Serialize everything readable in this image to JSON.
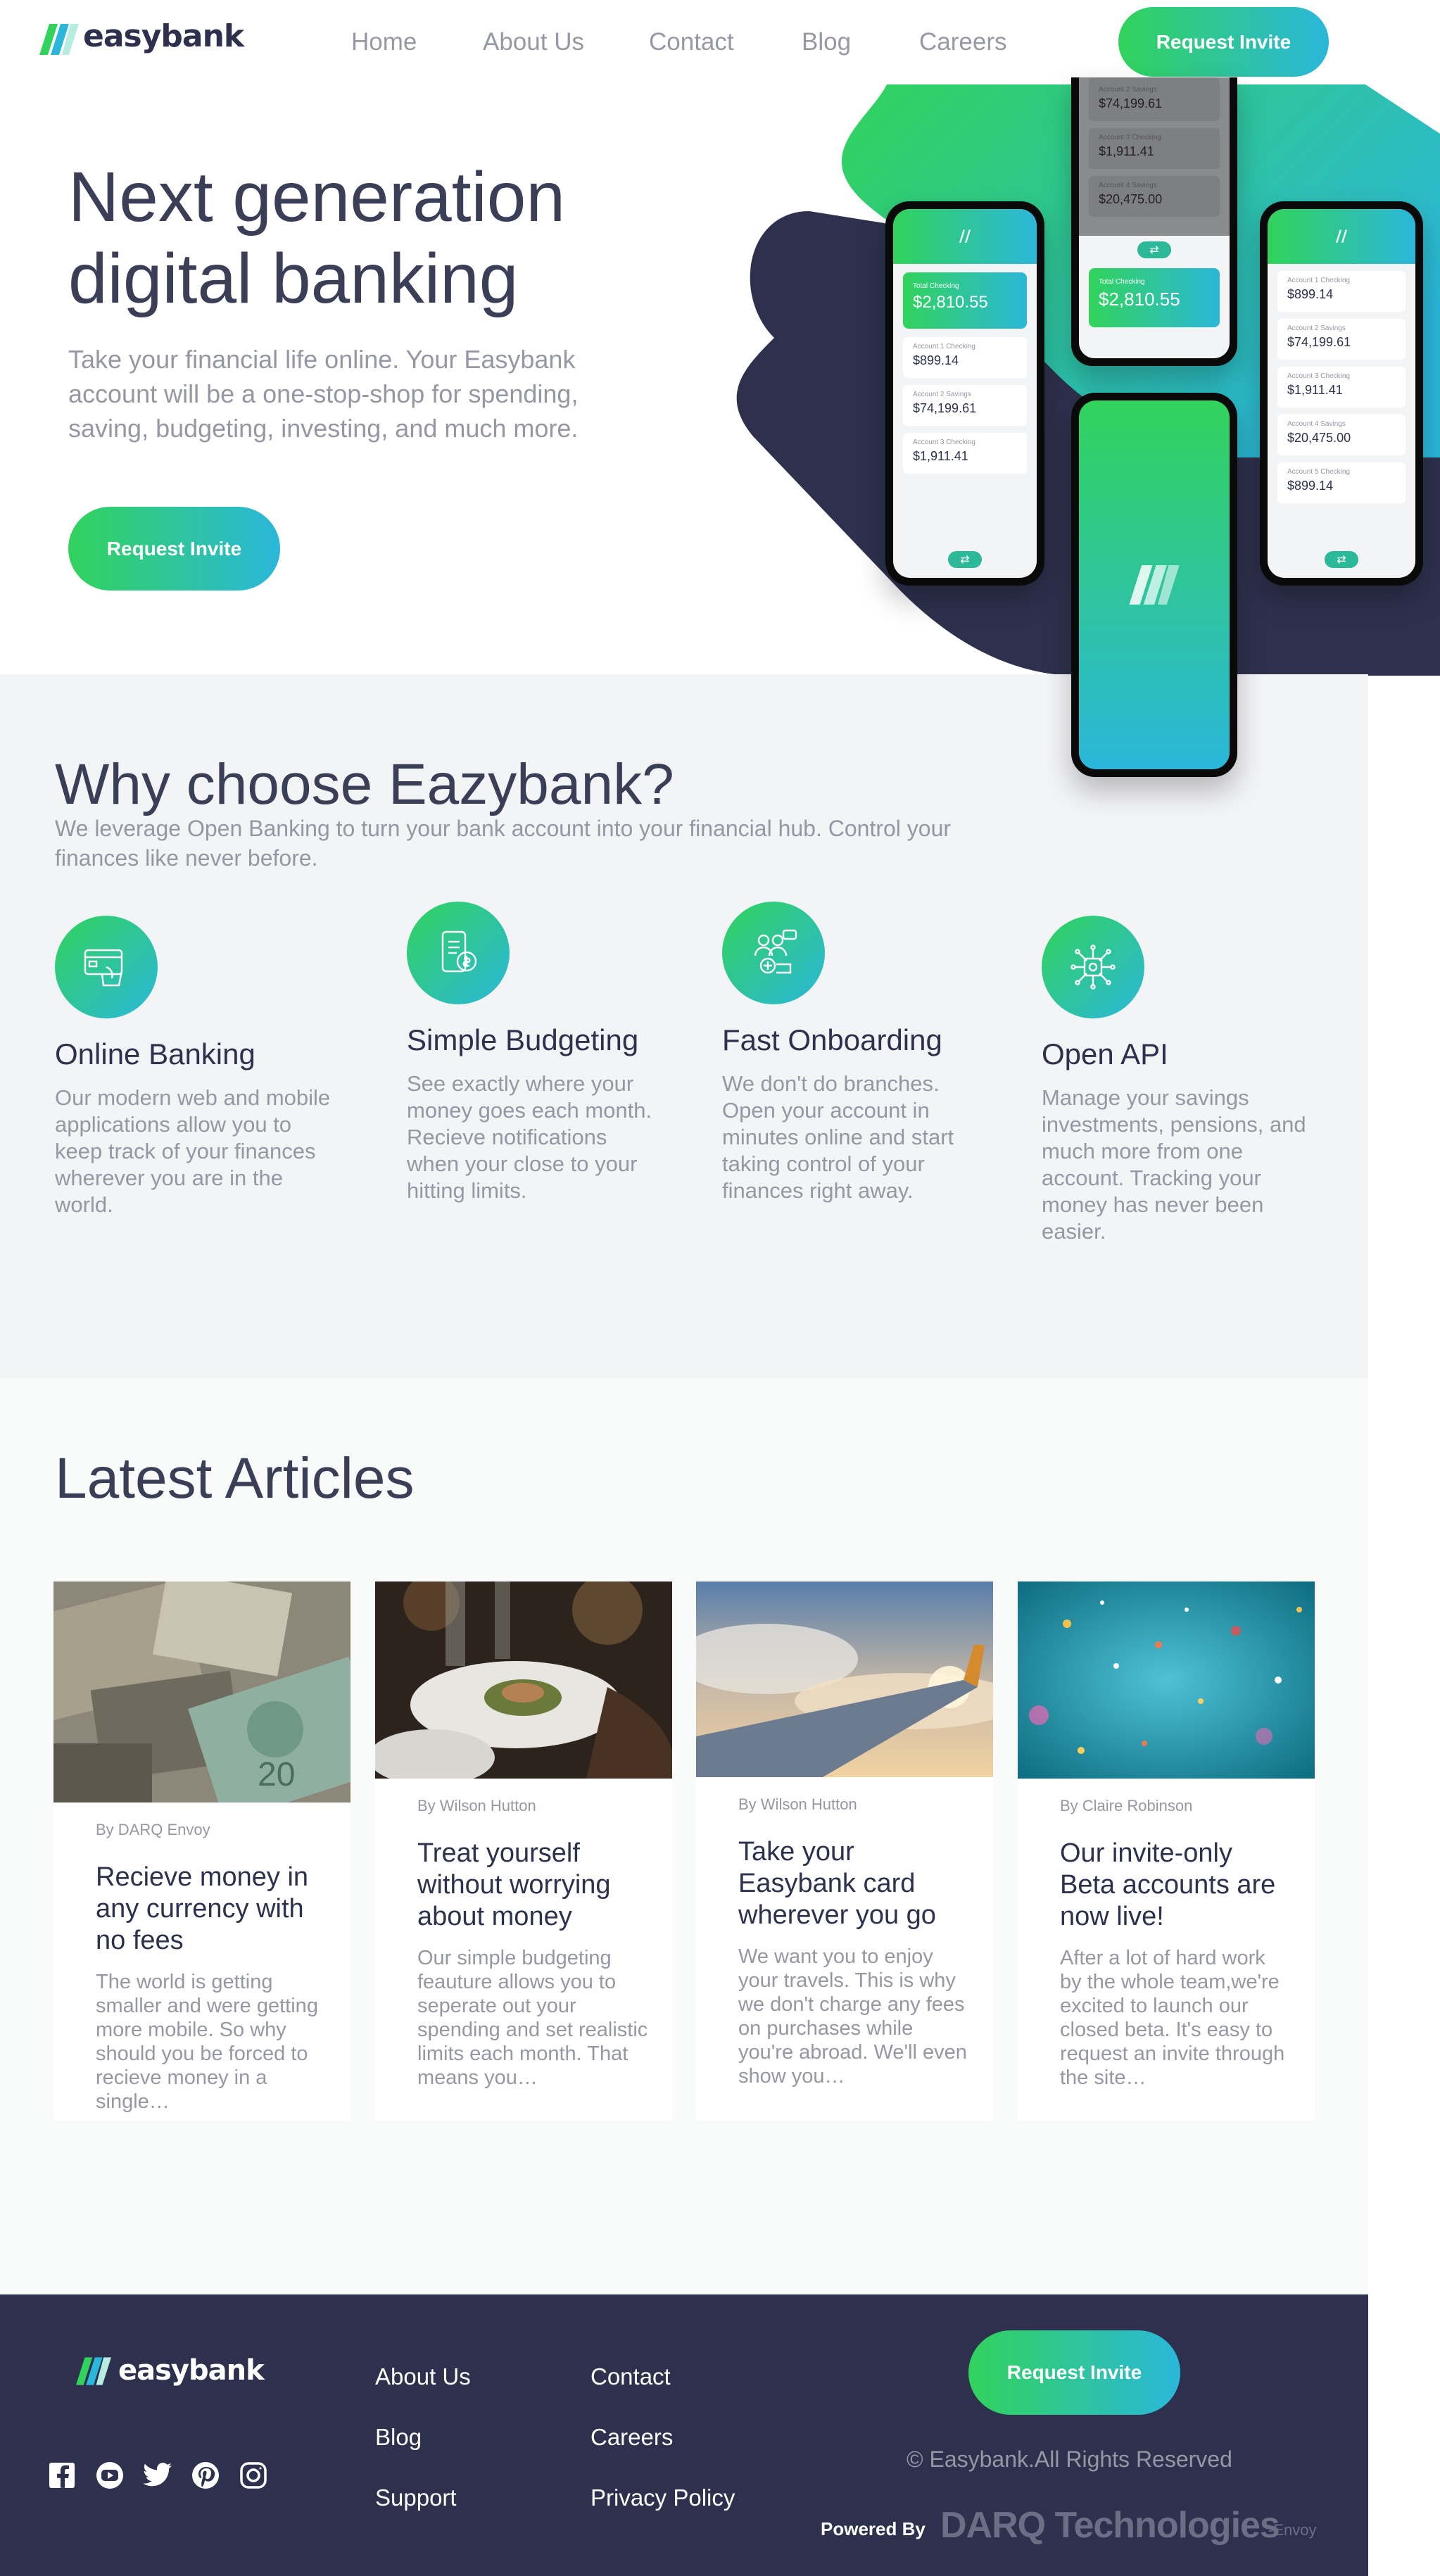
{
  "brand": {
    "name": "easybank"
  },
  "nav": {
    "links": [
      "Home",
      "About Us",
      "Contact",
      "Blog",
      "Careers"
    ],
    "cta": "Request Invite"
  },
  "hero": {
    "title": "Next generation digital banking",
    "text": "Take your financial life online. Your Easybank account will be a one-stop-shop for spending, saving, budgeting, investing, and much more.",
    "cta": "Request Invite"
  },
  "phones": {
    "total_label": "Total Checking",
    "total_amount": "$2,810.55",
    "accounts": [
      {
        "label": "Account 1 Checking",
        "amount": "$899.14"
      },
      {
        "label": "Account 2 Savings",
        "amount": "$74,199.61"
      },
      {
        "label": "Account 3 Checking",
        "amount": "$1,911.41"
      },
      {
        "label": "Account 4 Savings",
        "amount": "$20,475.00"
      },
      {
        "label": "Account 5 Checking",
        "amount": "$899.14"
      }
    ]
  },
  "why": {
    "title": "Why choose Eazybank?",
    "subtitle": "We leverage Open Banking to turn your bank account into your financial hub. Control your finances like never before.",
    "features": [
      {
        "icon": "online-banking-icon",
        "title": "Online Banking",
        "text": "Our modern web and mobile applications allow you to keep track of your finances wherever you are in the world."
      },
      {
        "icon": "budgeting-icon",
        "title": "Simple Budgeting",
        "text": "See exactly where your money goes each month. Recieve notifications when your close to your hitting limits."
      },
      {
        "icon": "onboarding-icon",
        "title": "Fast Onboarding",
        "text": "We don't do branches. Open your account in minutes online and start taking control of your finances right away."
      },
      {
        "icon": "api-icon",
        "title": "Open API",
        "text": "Manage your savings investments, pensions, and much more from one account. Tracking your money has never been easier."
      }
    ]
  },
  "articles": {
    "title": "Latest Articles",
    "items": [
      {
        "image": "currency-photo",
        "author": "By DARQ Envoy",
        "title": "Recieve money in any currency with no fees",
        "excerpt": "The world is getting smaller and were getting more mobile. So why should you be forced to recieve money in a single…"
      },
      {
        "image": "restaurant-photo",
        "author": "By Wilson Hutton",
        "title": "Treat yourself without worrying about money",
        "excerpt": "Our simple budgeting feauture allows you to seperate out your spending and set realistic limits each month. That means you…"
      },
      {
        "image": "plane-photo",
        "author": "By Wilson Hutton",
        "title": "Take your Easybank card wherever you go",
        "excerpt": "We want you to enjoy your travels. This is why we don't charge any fees on purchases while you're abroad. We'll even show you…"
      },
      {
        "image": "confetti-photo",
        "author": "By Claire Robinson",
        "title": "Our invite-only Beta accounts are now live!",
        "excerpt": "After a lot of hard work by the whole team,we're excited to launch our closed beta. It's easy to request an invite through the site…"
      }
    ]
  },
  "footer": {
    "links_col1": [
      "About Us",
      "Blog",
      "Support"
    ],
    "links_col2": [
      "Contact",
      "Careers",
      "Privacy Policy"
    ],
    "cta": "Request Invite",
    "copyright": "© Easybank.All Rights Reserved",
    "powered_label": "Powered By",
    "powered_name": "DARQ Technologies",
    "powered_suffix": "-Envoy",
    "socials": [
      "facebook-icon",
      "youtube-icon",
      "twitter-icon",
      "pinterest-icon",
      "instagram-icon"
    ]
  },
  "colors": {
    "dark_blue": "#2d314d",
    "lime_green": "#31d35c",
    "bright_cyan": "#2bb7da",
    "grayish_blue": "#9597a5",
    "light_gray": "#f3f4f6",
    "footer_bg": "#2d314d"
  }
}
